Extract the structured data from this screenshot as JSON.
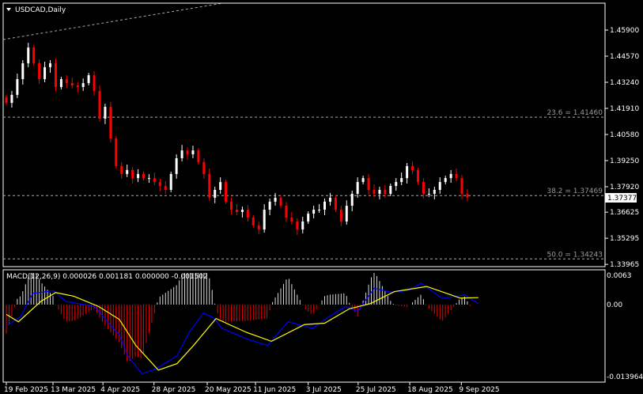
{
  "chart_data": {
    "type": "candlestick",
    "title": "USDCAD,Daily",
    "symbol": "USDCAD",
    "timeframe": "Daily",
    "price_ticks": [
      "1.45900",
      "1.44570",
      "1.43240",
      "1.41910",
      "1.40580",
      "1.39250",
      "1.37920",
      "1.36625",
      "1.35295",
      "1.33965"
    ],
    "price_tick_values": [
      1.459,
      1.4457,
      1.4324,
      1.4191,
      1.4058,
      1.3925,
      1.3792,
      1.36625,
      1.35295,
      1.33965
    ],
    "current_price": "1.37377",
    "fib_levels": [
      {
        "label": "23.6 = 1.41460",
        "value": 1.4146
      },
      {
        "label": "38.2 = 1.37469",
        "value": 1.37469
      },
      {
        "label": "50.0 = 1.34243",
        "value": 1.34243
      }
    ],
    "closes": [
      1.4219,
      1.426,
      1.434,
      1.4421,
      1.4501,
      1.4421,
      1.434,
      1.4401,
      1.4421,
      1.43,
      1.434,
      1.432,
      1.4308,
      1.43,
      1.432,
      1.436,
      1.428,
      1.4139,
      1.4199,
      1.4038,
      1.3897,
      1.3857,
      1.3877,
      1.3836,
      1.3857,
      1.3836,
      1.3836,
      1.3816,
      1.3796,
      1.3776,
      1.3857,
      1.3937,
      1.3977,
      1.3957,
      1.3977,
      1.3917,
      1.3857,
      1.3736,
      1.3776,
      1.3816,
      1.3716,
      1.3675,
      1.3663,
      1.3675,
      1.3635,
      1.3595,
      1.3574,
      1.3675,
      1.3716,
      1.3736,
      1.3695,
      1.3635,
      1.3615,
      1.3574,
      1.3615,
      1.3655,
      1.3675,
      1.3675,
      1.3716,
      1.3736,
      1.3675,
      1.3615,
      1.3695,
      1.3756,
      1.3816,
      1.3836,
      1.3776,
      1.3756,
      1.3776,
      1.3756,
      1.3796,
      1.3816,
      1.3836,
      1.3897,
      1.3877,
      1.3816,
      1.3756,
      1.3756,
      1.3776,
      1.3816,
      1.3836,
      1.3857,
      1.3836,
      1.3756,
      1.37377
    ],
    "date_ticks": [
      {
        "label": "19 Feb 2025",
        "bar": 0
      },
      {
        "label": "13 Mar 2025",
        "bar": 8.5
      },
      {
        "label": "4 Apr 2025",
        "bar": 17.6
      },
      {
        "label": "28 Apr 2025",
        "bar": 26.9
      },
      {
        "label": "20 May 2025",
        "bar": 36.6
      },
      {
        "label": "11 Jun 2025",
        "bar": 45.4
      },
      {
        "label": "3 Jul 2025",
        "bar": 55
      },
      {
        "label": "25 Jul 2025",
        "bar": 64.1
      },
      {
        "label": "18 Aug 2025",
        "bar": 73.5
      },
      {
        "label": "9 Sep 2025",
        "bar": 82.9
      }
    ],
    "macd": {
      "label": "MACD(12,26,9) 0.000026 0.001181 0.000000 -0.001502",
      "ticks": [
        "0.0063",
        "0.00",
        "-0.013964"
      ],
      "tick_values": [
        0.0063,
        0,
        -0.013964
      ],
      "main": [
        [
          0,
          -0.0046
        ],
        [
          2.6,
          -0.0026
        ],
        [
          4.8,
          0.0024
        ],
        [
          8.6,
          0.003
        ],
        [
          10.8,
          0.0007
        ],
        [
          16.1,
          -0.0004
        ],
        [
          18.3,
          -0.0035
        ],
        [
          20.6,
          -0.0065
        ],
        [
          22.1,
          -0.011
        ],
        [
          24.7,
          -0.0149
        ],
        [
          27.3,
          -0.0138
        ],
        [
          31.1,
          -0.011
        ],
        [
          33.3,
          -0.006
        ],
        [
          35.9,
          -0.0018
        ],
        [
          37.8,
          -0.0029
        ],
        [
          39.3,
          -0.0051
        ],
        [
          43.8,
          -0.0074
        ],
        [
          47.6,
          -0.0088
        ],
        [
          51.3,
          -0.0037
        ],
        [
          55.8,
          -0.0051
        ],
        [
          58.8,
          -0.0026
        ],
        [
          61.8,
          -0.0004
        ],
        [
          64,
          -0.0015
        ],
        [
          67,
          0.0035
        ],
        [
          70,
          0.0027
        ],
        [
          73,
          0.003
        ],
        [
          75.6,
          0.0046
        ],
        [
          79.4,
          0.0013
        ],
        [
          83.5,
          0.0021
        ],
        [
          86,
          0.0002
        ]
      ],
      "signal": [
        [
          0,
          -0.0021
        ],
        [
          2.2,
          -0.0037
        ],
        [
          6.3,
          0.0007
        ],
        [
          9,
          0.0026
        ],
        [
          12.3,
          0.0018
        ],
        [
          16.8,
          -0.0004
        ],
        [
          20.6,
          -0.0032
        ],
        [
          23.6,
          -0.0088
        ],
        [
          27.7,
          -0.0141
        ],
        [
          31.1,
          -0.0127
        ],
        [
          34.1,
          -0.0088
        ],
        [
          38.2,
          -0.003
        ],
        [
          43.8,
          -0.006
        ],
        [
          48.3,
          -0.0079
        ],
        [
          54.3,
          -0.0043
        ],
        [
          58,
          -0.004
        ],
        [
          62.5,
          -0.0009
        ],
        [
          66.3,
          0.0002
        ],
        [
          70.7,
          0.0028
        ],
        [
          76.6,
          0.0039
        ],
        [
          82.7,
          0.0014
        ],
        [
          86,
          0.0015
        ]
      ]
    },
    "colors": {
      "bull": "#ffffff",
      "bear": "#ff0000",
      "macd": "#0000ff",
      "signal": "#ffff00",
      "grid": "#ffffff"
    }
  }
}
